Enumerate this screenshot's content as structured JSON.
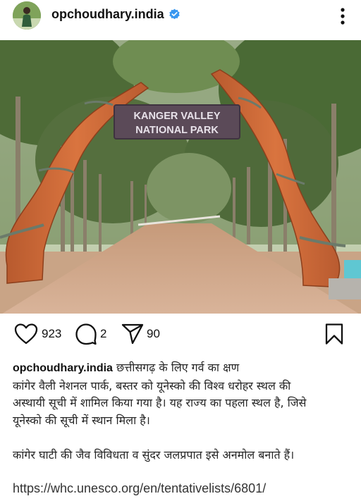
{
  "header": {
    "username": "opchoudhary.india",
    "verified_icon": "verified-badge-icon",
    "more_icon": "more-options-icon"
  },
  "photo": {
    "sign_line1": "KANGER VALLEY",
    "sign_line2": "NATIONAL PARK"
  },
  "actions": {
    "likes": "923",
    "comments": "2",
    "shares": "90"
  },
  "caption": {
    "username": "opchoudhary.india",
    "line1_rest": " छत्तीसगढ़ के लिए गर्व का क्षण",
    "line2": "कांगेर वैली नेशनल पार्क, बस्तर को यूनेस्को की विश्व धरोहर स्थल की",
    "line3": "अस्थायी सूची में शामिल किया गया है। यह राज्य का पहला स्थल है, जिसे",
    "line4": "यूनेस्को की सूची में स्थान मिला है।",
    "line5": "कांगेर घाटी की जैव विविधता व सुंदर जलप्रपात इसे अनमोल बनाते हैं।",
    "link": "https://whc.unesco.org/en/tentativelists/6801/"
  },
  "colors": {
    "verified": "#3897f0",
    "text": "#111111",
    "sign": "#5b4a58"
  }
}
